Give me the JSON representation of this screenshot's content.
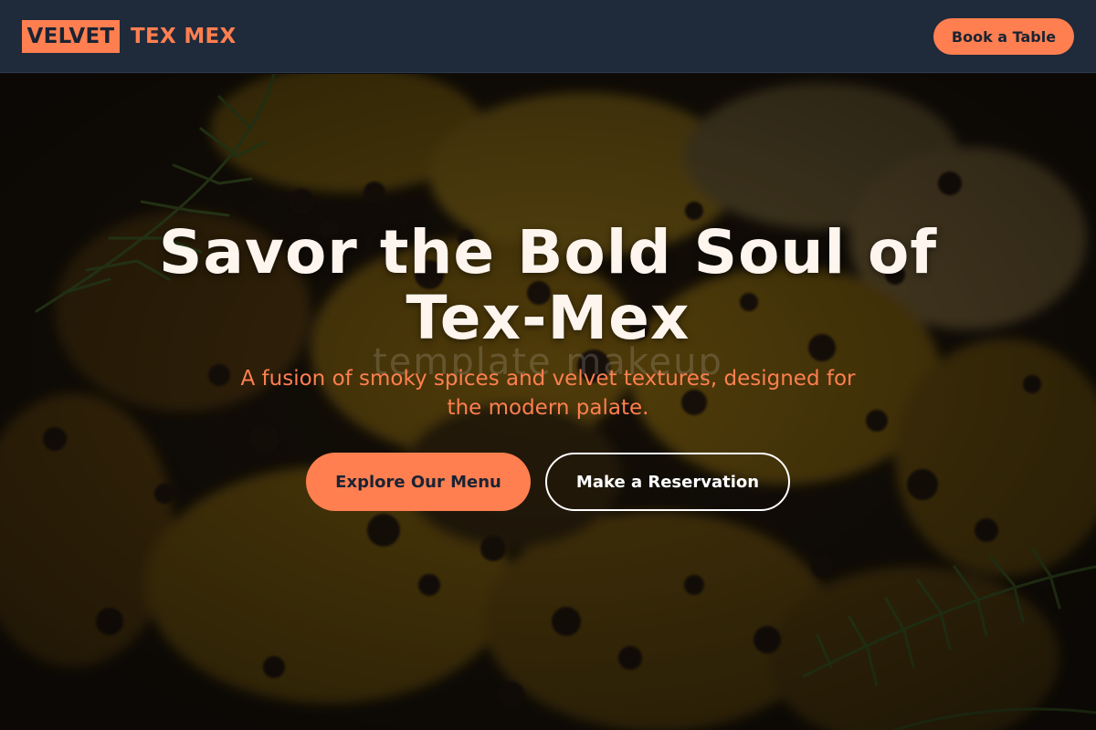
{
  "header": {
    "logo_primary": "VELVET",
    "logo_secondary": "TEX MEX",
    "book_button_label": "Book a Table"
  },
  "hero": {
    "headline": "Savor the Bold Soul of Tex-Mex",
    "watermark": "template makeup",
    "subtitle": "A fusion of smoky spices and velvet textures, designed for the modern palate.",
    "primary_cta_label": "Explore Our Menu",
    "secondary_cta_label": "Make a Reservation",
    "background_image": "tex-mex-dish-with-herbs"
  },
  "colors": {
    "accent": "#ff7f50",
    "header_bg": "#1f2a3b",
    "headline_text": "#fdf5ee",
    "button_text_dark": "#1b2333"
  }
}
